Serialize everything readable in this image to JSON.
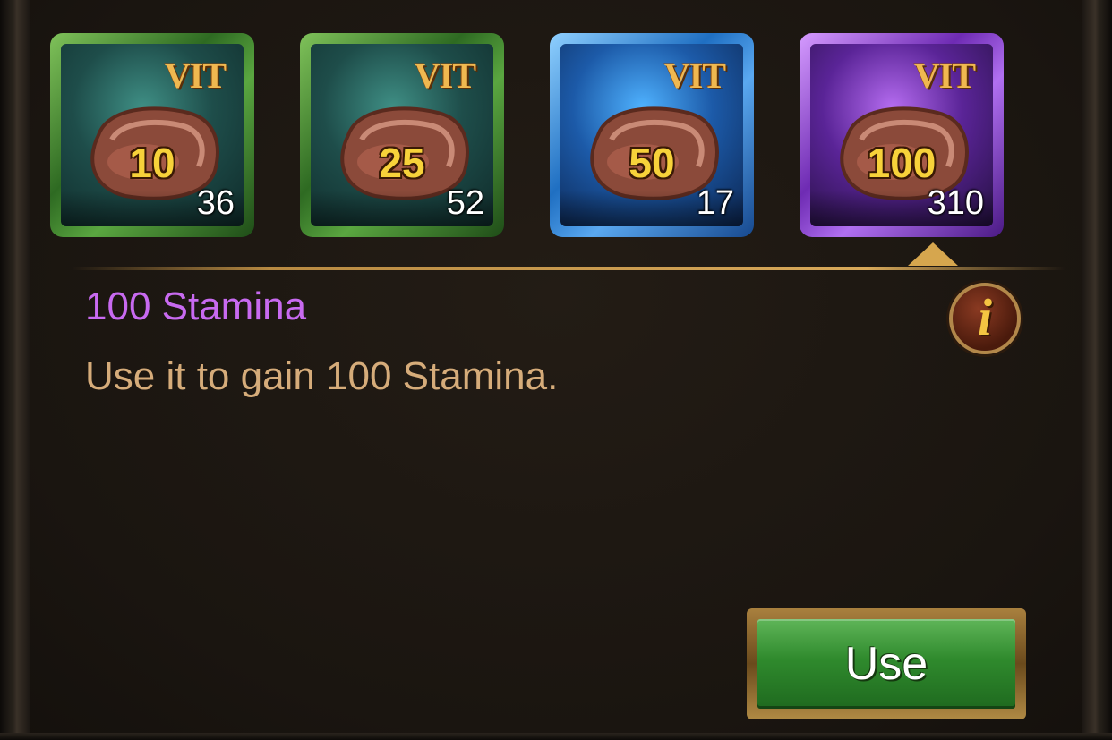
{
  "items": [
    {
      "tier": "green",
      "tag": "VIT",
      "amount": "10",
      "count": "36"
    },
    {
      "tier": "green",
      "tag": "VIT",
      "amount": "25",
      "count": "52"
    },
    {
      "tier": "blue",
      "tag": "VIT",
      "amount": "50",
      "count": "17"
    },
    {
      "tier": "purple",
      "tag": "VIT",
      "amount": "100",
      "count": "310"
    }
  ],
  "selected": {
    "title": "100 Stamina",
    "description": "Use it to gain 100 Stamina.",
    "info_icon": "i"
  },
  "actions": {
    "use_label": "Use"
  },
  "colors": {
    "title": "#c86af0",
    "description": "#d6ac7a",
    "use_button": "#2f8a2d"
  },
  "icons": {
    "item_icon": "meat-icon",
    "info": "info-icon"
  }
}
